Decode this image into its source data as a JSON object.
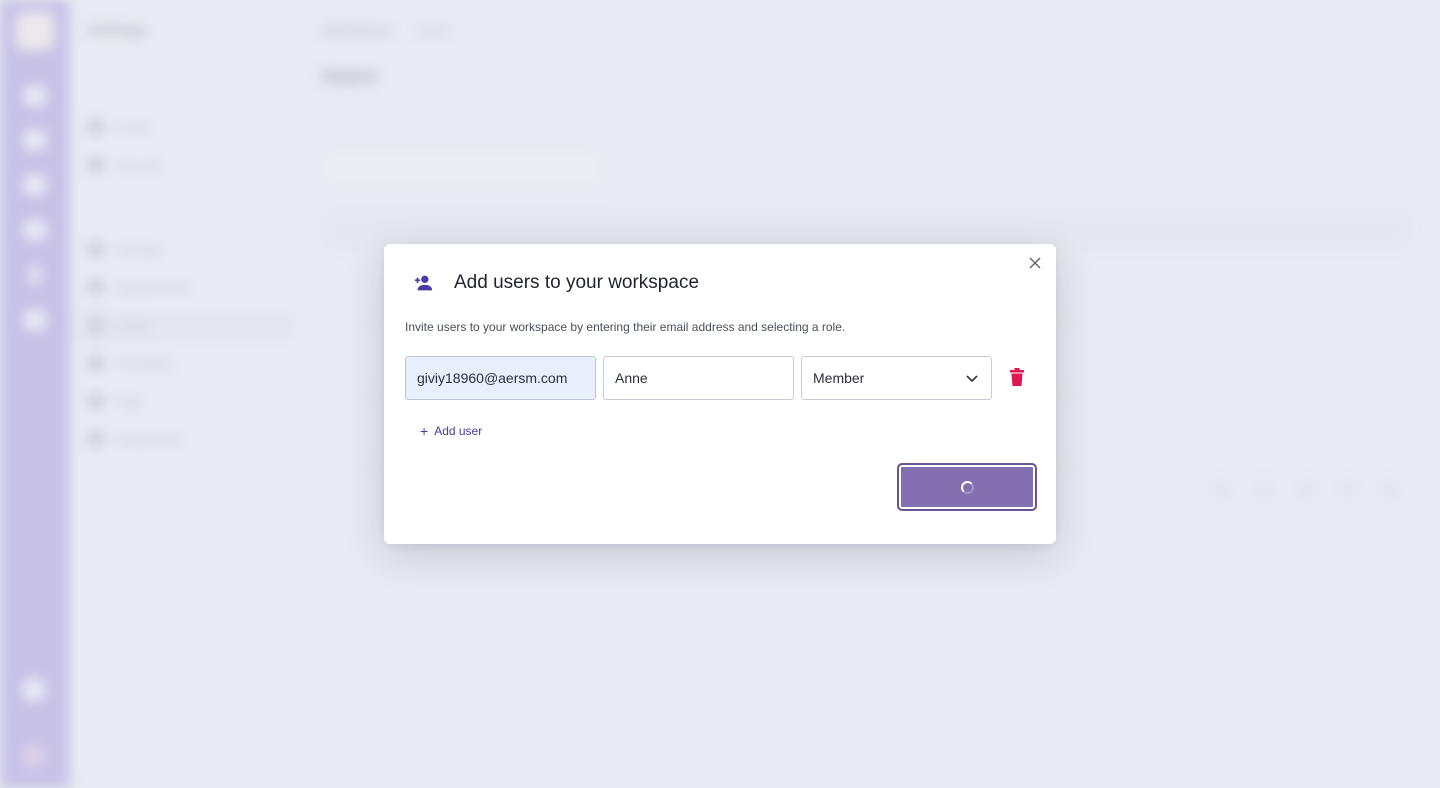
{
  "background": {
    "app_title": "Settings",
    "breadcrumb": [
      "Workspace",
      "Users"
    ],
    "page_title": "Users",
    "nav_items": [
      "Profile",
      "Security",
      "Settings",
      "Departments",
      "Users",
      "Templates",
      "Tags",
      "Integrations"
    ]
  },
  "dialog": {
    "title": "Add users to your workspace",
    "description": "Invite users to your workspace by entering their email address and selecting a role.",
    "rows": [
      {
        "email": "giviy18960@aersm.com",
        "name": "Anne",
        "role": "Member"
      }
    ],
    "add_user_label": "Add user",
    "icons": {
      "header": "add-person-icon",
      "close": "close-icon",
      "delete": "trash-icon",
      "dropdown": "chevron-down-icon",
      "add": "plus-icon",
      "loading": "spinner-icon"
    },
    "colors": {
      "accent": "#4b3aa8",
      "submit": "#8370b0",
      "delete": "#e0174f"
    }
  }
}
